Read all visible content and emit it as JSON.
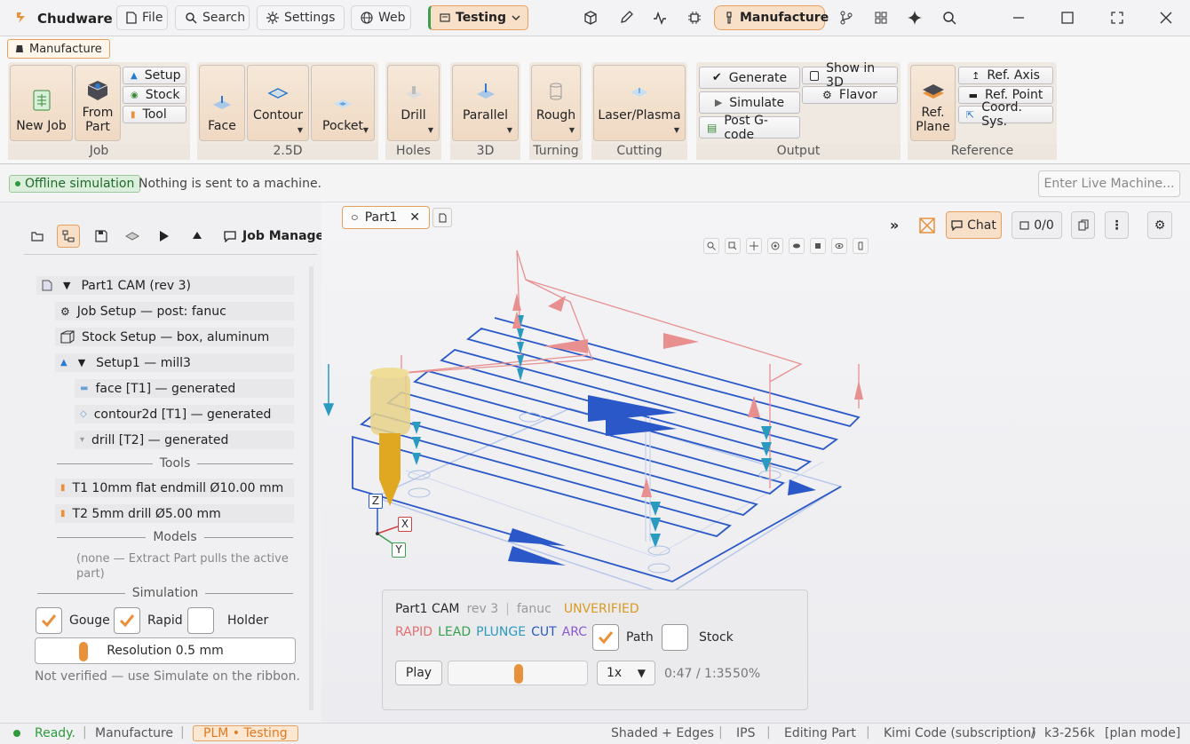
{
  "app": {
    "name": "Chudware"
  },
  "titlebar": {
    "file": "File",
    "search": "Search",
    "settings": "Settings",
    "web": "Web",
    "env_badge": "Testing",
    "workspace": "Manufacture"
  },
  "ribbon": {
    "active_tab": "Manufacture",
    "groups": {
      "job": "Job",
      "d25": "2.5D",
      "holes": "Holes",
      "d3": "3D",
      "turning": "Turning",
      "cutting": "Cutting",
      "output": "Output",
      "reference": "Reference"
    },
    "buttons": {
      "new_job": "New Job",
      "from_part_1": "From",
      "from_part_2": "Part",
      "setup": "Setup",
      "stock": "Stock",
      "tool": "Tool",
      "face": "Face",
      "contour": "Contour",
      "pocket": "Pocket",
      "drill": "Drill",
      "parallel": "Parallel",
      "rough": "Rough",
      "laser": "Laser/Plasma",
      "generate": "Generate",
      "simulate": "Simulate",
      "post_gcode": "Post G-code",
      "show_in_3d": "Show in 3D",
      "flavor": "Flavor",
      "ref_plane_1": "Ref.",
      "ref_plane_2": "Plane",
      "ref_axis": "Ref. Axis",
      "ref_point": "Ref. Point",
      "coord_sys": "Coord. Sys."
    }
  },
  "status_strip": {
    "badge": "Offline simulation",
    "message": "Nothing is sent to a machine.",
    "live_button": "Enter Live Machine..."
  },
  "job_manager": {
    "title": "Job Manager",
    "tree": [
      {
        "label": "Part1 CAM  (rev 3)"
      },
      {
        "label": "Job Setup — post: fanuc"
      },
      {
        "label": "Stock Setup — box, aluminum"
      },
      {
        "label": "Setup1  —  mill3"
      },
      {
        "label": "face  [T1]  — generated"
      },
      {
        "label": "contour2d  [T1]  — generated"
      },
      {
        "label": "drill  [T2]  — generated"
      }
    ],
    "tools_heading": "Tools",
    "tools": [
      "T1  10mm flat endmill  Ø10.00 mm",
      "T2  5mm drill  Ø5.00 mm"
    ],
    "models_heading": "Models",
    "models_note": "(none — Extract Part pulls the active part)",
    "simulation_heading": "Simulation",
    "sim_checks": {
      "gouge": "Gouge",
      "rapid": "Rapid",
      "holder": "Holder"
    },
    "sim_checks_state": {
      "gouge": true,
      "rapid": true,
      "holder": false
    },
    "resolution": "Resolution 0.5 mm",
    "not_verified": "Not verified — use Simulate on the ribbon."
  },
  "viewport": {
    "doc_tab": "Part1",
    "chat": "Chat",
    "counter": "0/0",
    "axes": {
      "x": "X",
      "y": "Y",
      "z": "Z"
    }
  },
  "sim_panel": {
    "name": "Part1 CAM",
    "rev": "rev 3",
    "post": "fanuc",
    "state": "UNVERIFIED",
    "legend": [
      {
        "label": "RAPID",
        "color": "#e07070"
      },
      {
        "label": "LEAD",
        "color": "#3aa050"
      },
      {
        "label": "PLUNGE",
        "color": "#2a9ac0"
      },
      {
        "label": "CUT",
        "color": "#2a58c8"
      },
      {
        "label": "ARC",
        "color": "#8a5ad0"
      }
    ],
    "path": "Path",
    "stock": "Stock",
    "path_checked": true,
    "stock_checked": false,
    "play": "Play",
    "speed": "1x",
    "time": "0:47 / 1:35",
    "pct": "50%",
    "progress": 0.5
  },
  "bottombar": {
    "ready": "Ready.",
    "workspace": "Manufacture",
    "plm": "PLM • Testing",
    "shading": "Shaded + Edges",
    "units": "IPS",
    "mode": "Editing Part",
    "model": "Kimi Code (subscription)",
    "ctx": "k3-256k",
    "plan": "[plan mode]"
  },
  "colors": {
    "accent": "#e8913a",
    "cut": "#2a58c8",
    "rapid": "#e07070",
    "plunge": "#2a9ac0",
    "ok": "#2e9a3c"
  }
}
